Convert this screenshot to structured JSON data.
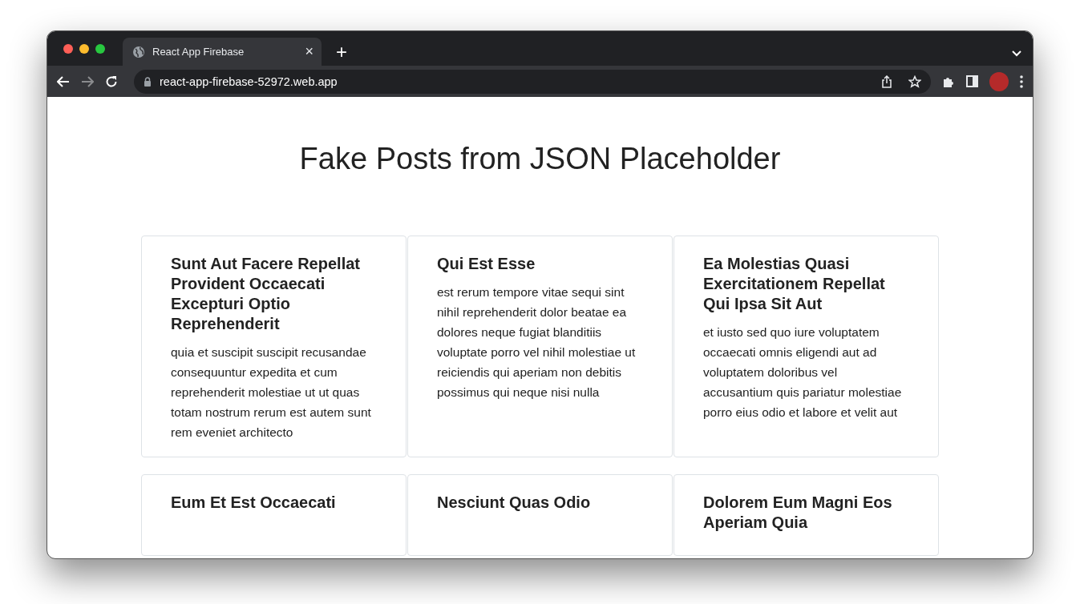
{
  "browser": {
    "tab_title": "React App Firebase",
    "tab_close": "×",
    "new_tab": "+",
    "url": "react-app-firebase-52972.web.app"
  },
  "page": {
    "heading": "Fake Posts from JSON Placeholder"
  },
  "posts": [
    {
      "title": "Sunt Aut Facere Repellat Provident Occaecati Excepturi Optio Reprehenderit",
      "body": "quia et suscipit suscipit recusandae consequuntur expedita et cum reprehenderit molestiae ut ut quas totam nostrum rerum est autem sunt rem eveniet architecto"
    },
    {
      "title": "Qui Est Esse",
      "body": "est rerum tempore vitae sequi sint nihil reprehenderit dolor beatae ea dolores neque fugiat blanditiis voluptate porro vel nihil molestiae ut reiciendis qui aperiam non debitis possimus qui neque nisi nulla"
    },
    {
      "title": "Ea Molestias Quasi Exercitationem Repellat Qui Ipsa Sit Aut",
      "body": "et iusto sed quo iure voluptatem occaecati omnis eligendi aut ad voluptatem doloribus vel accusantium quis pariatur molestiae porro eius odio et labore et velit aut"
    },
    {
      "title": "Eum Et Est Occaecati"
    },
    {
      "title": "Nesciunt Quas Odio"
    },
    {
      "title": "Dolorem Eum Magni Eos Aperiam Quia"
    }
  ]
}
